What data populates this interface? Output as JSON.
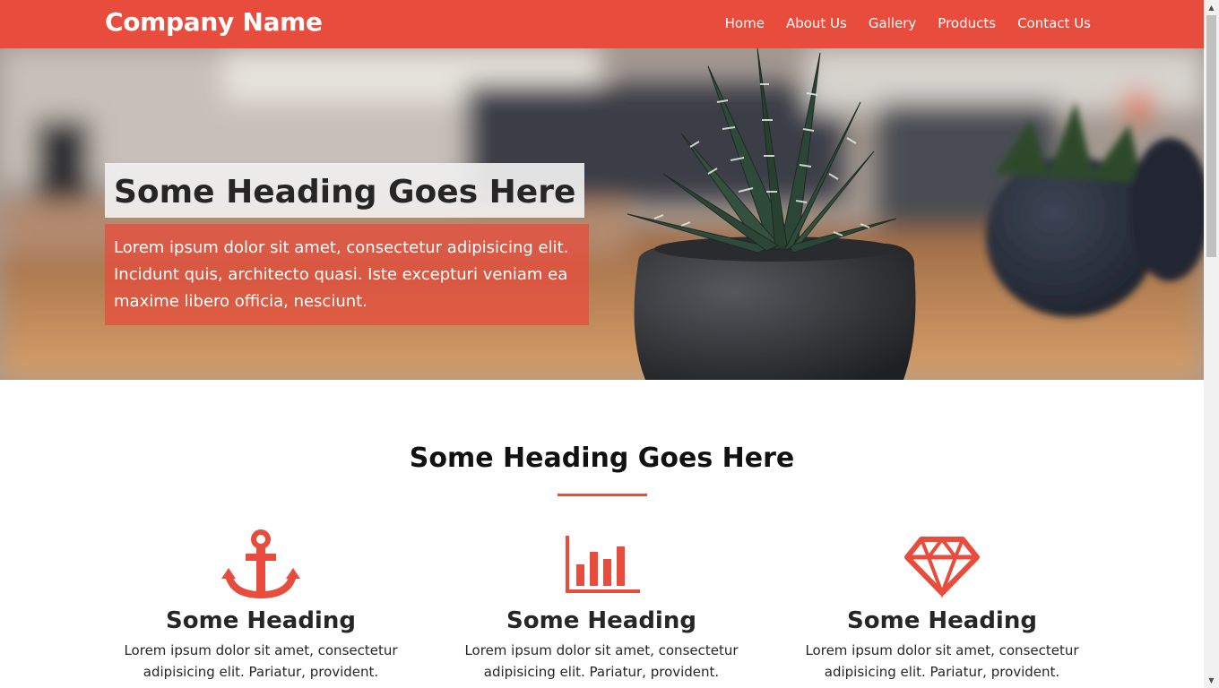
{
  "navbar": {
    "brand": "Company Name",
    "links": [
      "Home",
      "About Us",
      "Gallery",
      "Products",
      "Contact Us"
    ],
    "background": "#e74c3c"
  },
  "hero": {
    "title": "Some Heading Goes Here",
    "text": "Lorem ipsum dolor sit amet, consectetur adipisicing elit. Incidunt quis, architecto quasi. Iste excepturi veniam ea maxime libero officia, nesciunt.",
    "image": "potted-succulent-photo"
  },
  "section": {
    "title": "Some Heading Goes Here",
    "accent": "#e74c3c",
    "features": [
      {
        "icon": "anchor-icon",
        "heading": "Some Heading",
        "text": "Lorem ipsum dolor sit amet, consectetur adipisicing elit. Pariatur, provident."
      },
      {
        "icon": "bar-chart-icon",
        "heading": "Some Heading",
        "text": "Lorem ipsum dolor sit amet, consectetur adipisicing elit. Pariatur, provident."
      },
      {
        "icon": "diamond-icon",
        "heading": "Some Heading",
        "text": "Lorem ipsum dolor sit amet, consectetur adipisicing elit. Pariatur, provident."
      }
    ]
  }
}
